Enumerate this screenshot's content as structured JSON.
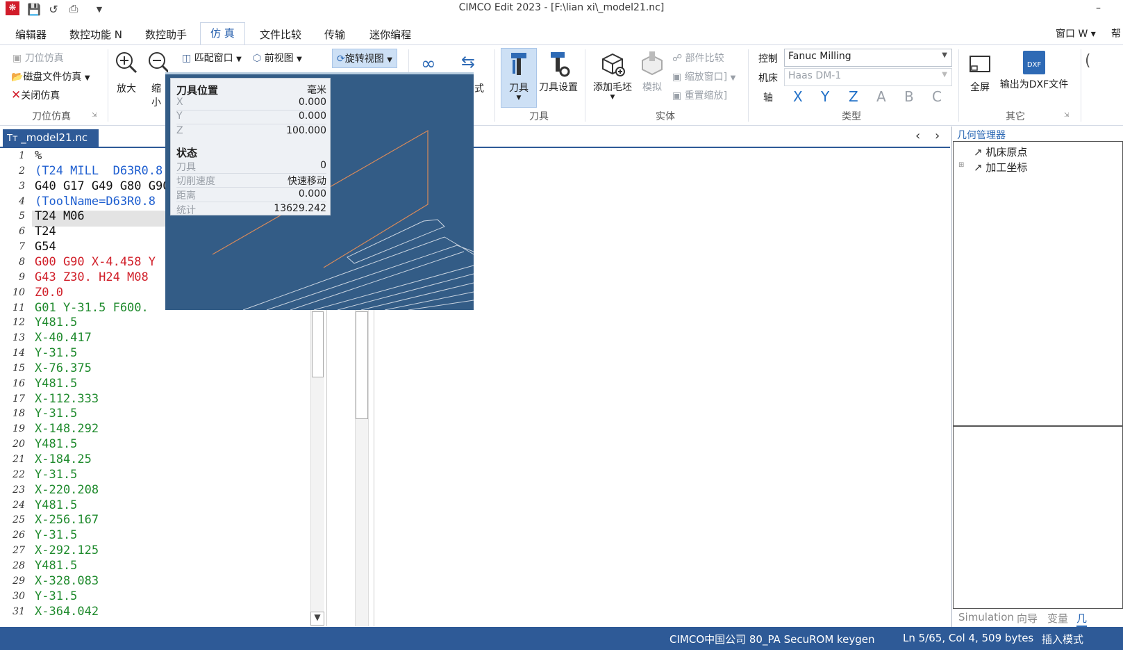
{
  "window": {
    "title": "CIMCO Edit 2023 - [F:\\lian xi\\_model21.nc]",
    "logo": "❋",
    "minimize": "–"
  },
  "menu": {
    "tabs": [
      "编辑器",
      "数控功能 N",
      "数控助手",
      "仿 真",
      "文件比较",
      "传输",
      "迷你编程"
    ],
    "window_menu": "窗口 W ▾"
  },
  "ribbon": {
    "toolpath_group": {
      "label": "刀位仿真",
      "items": [
        "刀位仿真",
        "磁盘文件仿真",
        "关闭仿真"
      ]
    },
    "zoom_in": "放大",
    "zoom_out": "缩小",
    "fit_window": "匹配窗口",
    "front_view": "前视图",
    "rotate_view": "旋转视图",
    "mode": "式",
    "tool_group": {
      "label": "刀具",
      "tool": "刀具",
      "tool_settings": "刀具设置"
    },
    "solid_group": {
      "label": "实体",
      "add_stock": "添加毛坯",
      "simulate": "模拟",
      "part_compare": "部件比较",
      "zoom_window": "缩放窗口]",
      "reset_zoom": "重置缩放]"
    },
    "type_group": {
      "label": "类型",
      "control_label": "控制",
      "control_value": "Fanuc Milling",
      "machine_label": "机床",
      "machine_value": "Haas DM-1",
      "axis_label": "轴",
      "axes": [
        "X",
        "Y",
        "Z",
        "A",
        "B",
        "C"
      ]
    },
    "other_group": {
      "label": "其它",
      "fullscreen": "全屏",
      "export_dxf": "输出为DXF文件",
      "dxf_badge": "DXF"
    }
  },
  "editor": {
    "tab_label": "_model21.nc",
    "tab_close": "×",
    "lines": [
      {
        "n": "1",
        "text": "%",
        "color": "#222222"
      },
      {
        "n": "2",
        "text": "(T24 MILL  D63R0.8",
        "color": "#1f5fd0"
      },
      {
        "n": "3",
        "text": "G40 G17 G49 G80 G90",
        "color": "#111111"
      },
      {
        "n": "4",
        "text": "(ToolName=D63R0.8",
        "color": "#1f5fd0"
      },
      {
        "n": "5",
        "text": "T24 M06",
        "color": "#111111"
      },
      {
        "n": "6",
        "text": "T24",
        "color": "#111111"
      },
      {
        "n": "7",
        "text": "G54",
        "color": "#111111"
      },
      {
        "n": "8",
        "text": "G00 G90 X-4.458 Y",
        "color": "#d1202a"
      },
      {
        "n": "9",
        "text": "G43 Z30. H24 M08",
        "color": "#d1202a"
      },
      {
        "n": "10",
        "text": "Z0.0",
        "color": "#d1202a"
      },
      {
        "n": "11",
        "text": "G01 Y-31.5 F600.",
        "color": "#1e8a2c"
      },
      {
        "n": "12",
        "text": "Y481.5",
        "color": "#1e8a2c"
      },
      {
        "n": "13",
        "text": "X-40.417",
        "color": "#1e8a2c"
      },
      {
        "n": "14",
        "text": "Y-31.5",
        "color": "#1e8a2c"
      },
      {
        "n": "15",
        "text": "X-76.375",
        "color": "#1e8a2c"
      },
      {
        "n": "16",
        "text": "Y481.5",
        "color": "#1e8a2c"
      },
      {
        "n": "17",
        "text": "X-112.333",
        "color": "#1e8a2c"
      },
      {
        "n": "18",
        "text": "Y-31.5",
        "color": "#1e8a2c"
      },
      {
        "n": "19",
        "text": "X-148.292",
        "color": "#1e8a2c"
      },
      {
        "n": "20",
        "text": "Y481.5",
        "color": "#1e8a2c"
      },
      {
        "n": "21",
        "text": "X-184.25",
        "color": "#1e8a2c"
      },
      {
        "n": "22",
        "text": "Y-31.5",
        "color": "#1e8a2c"
      },
      {
        "n": "23",
        "text": "X-220.208",
        "color": "#1e8a2c"
      },
      {
        "n": "24",
        "text": "Y481.5",
        "color": "#1e8a2c"
      },
      {
        "n": "25",
        "text": "X-256.167",
        "color": "#1e8a2c"
      },
      {
        "n": "26",
        "text": "Y-31.5",
        "color": "#1e8a2c"
      },
      {
        "n": "27",
        "text": "X-292.125",
        "color": "#1e8a2c"
      },
      {
        "n": "28",
        "text": "Y481.5",
        "color": "#1e8a2c"
      },
      {
        "n": "29",
        "text": "X-328.083",
        "color": "#1e8a2c"
      },
      {
        "n": "30",
        "text": "Y-31.5",
        "color": "#1e8a2c"
      },
      {
        "n": "31",
        "text": "X-364.042",
        "color": "#1e8a2c"
      }
    ]
  },
  "sim_info": {
    "header_label": "刀具位置",
    "unit": "毫米",
    "x_label": "X",
    "x_value": "0.000",
    "y_label": "Y",
    "y_value": "0.000",
    "z_label": "Z",
    "z_value": "100.000",
    "status_label": "状态",
    "tool_label": "刀具",
    "tool_value": "0",
    "feed_label": "切削速度",
    "feed_value": "快速移动",
    "dist_label": "距离",
    "dist_value": "0.000",
    "total_label": "统计",
    "total_value": "13629.242"
  },
  "geometry_manager": {
    "title": "几何管理器",
    "items": [
      "机床原点",
      "加工坐标"
    ],
    "bottom_tabs": [
      "Simulation",
      "向导",
      "变量",
      "几"
    ]
  },
  "statusbar": {
    "company": "CIMCO中国公司 80_PA SecuROM keygen",
    "position": "Ln 5/65, Col 4, 509 bytes",
    "mode": "插入模式"
  },
  "colors": {
    "accent": "#2e5a97",
    "sim_bg": "#335c86"
  }
}
